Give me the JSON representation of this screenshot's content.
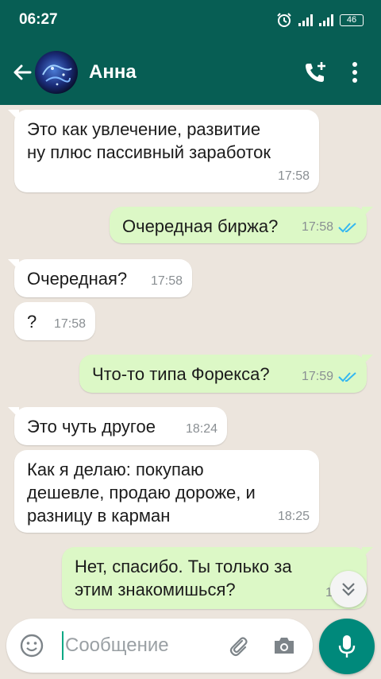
{
  "status_bar": {
    "time": "06:27",
    "battery": "46"
  },
  "header": {
    "contact_name": "Анна"
  },
  "messages": [
    {
      "dir": "in",
      "lines": [
        "Это как увлечение,  развитие",
        "ну плюс пассивный заработок"
      ],
      "time": "17:58"
    },
    {
      "dir": "out",
      "lines": [
        "Очередная биржа?"
      ],
      "time": "17:58",
      "read": true
    },
    {
      "dir": "in",
      "lines": [
        "Очередная?"
      ],
      "time": "17:58"
    },
    {
      "dir": "in",
      "lines": [
        "?"
      ],
      "time": "17:58"
    },
    {
      "dir": "out",
      "lines": [
        "Что-то типа Форекса?"
      ],
      "time": "17:59",
      "read": true
    },
    {
      "dir": "in",
      "lines": [
        "Это чуть другое"
      ],
      "time": "18:24"
    },
    {
      "dir": "in",
      "lines": [
        "Как я делаю: покупаю",
        "дешевле, продаю дороже, и",
        "разницу в карман"
      ],
      "time": "18:25"
    },
    {
      "dir": "out",
      "lines": [
        "Нет, спасибо. Ты только за",
        "этим знакомишься?"
      ],
      "time": "18:32"
    }
  ],
  "composer": {
    "placeholder": "Сообщение"
  },
  "colors": {
    "header": "#075e54",
    "outgoing": "#dcf8c6",
    "incoming": "#ffffff",
    "mic": "#00897b",
    "read_ticks": "#34b7f1"
  }
}
